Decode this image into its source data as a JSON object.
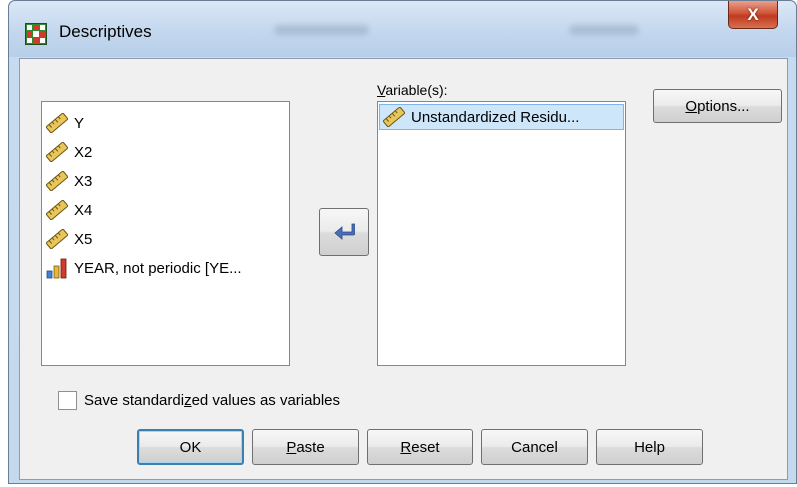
{
  "window": {
    "title": "Descriptives",
    "close_glyph": "X",
    "icon": "spss-app-icon"
  },
  "source_list": {
    "items": [
      {
        "label": "Y",
        "icon": "scale-ruler-icon"
      },
      {
        "label": "X2",
        "icon": "scale-ruler-icon"
      },
      {
        "label": "X3",
        "icon": "scale-ruler-icon"
      },
      {
        "label": "X4",
        "icon": "scale-ruler-icon"
      },
      {
        "label": "X5",
        "icon": "scale-ruler-icon"
      },
      {
        "label": "YEAR, not periodic [YE...",
        "icon": "ordinal-bar-icon"
      }
    ]
  },
  "move_button": {
    "icon": "arrow-move-icon"
  },
  "variables": {
    "label_pre": "",
    "label_mnemonic": "V",
    "label_post": "ariable(s):",
    "items": [
      {
        "label": "Unstandardized Residu...",
        "icon": "scale-ruler-icon",
        "selected": true
      }
    ]
  },
  "options_button": {
    "mnemonic": "O",
    "rest": "ptions..."
  },
  "save_checkbox": {
    "checked": false,
    "label_pre": "Save standardi",
    "label_mnemonic": "z",
    "label_post": "ed values as variables"
  },
  "buttons": {
    "ok": "OK",
    "paste_mnemonic": "P",
    "paste_rest": "aste",
    "reset_mnemonic": "R",
    "reset_rest": "eset",
    "cancel": "Cancel",
    "help": "Help"
  },
  "colors": {
    "selection_bg": "#cde6fa",
    "selection_border": "#7eb4ea",
    "close_button": "#c8452a",
    "default_button_border": "#3c7fb1"
  }
}
